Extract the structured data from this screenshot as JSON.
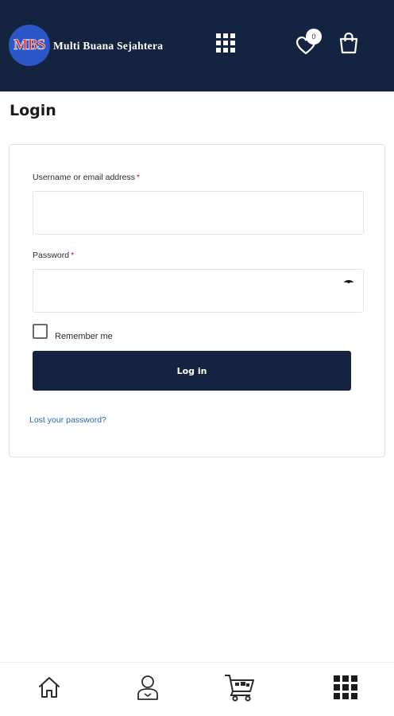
{
  "header": {
    "logo_text": "MBS",
    "brand_name": "Multi Buana Sejahtera",
    "menu_icon": "grid-menu-icon",
    "wishlist_icon": "heart-tag-icon",
    "wishlist_count": "0",
    "cart_icon": "shopping-bag-icon"
  },
  "page": {
    "title": "Login"
  },
  "form": {
    "username_label": "Username or email address",
    "username_value": "",
    "password_label": "Password",
    "password_value": "",
    "required_mark": "*",
    "show_password_icon": "eye-icon",
    "remember_label": "Remember me",
    "remember_checked": false,
    "submit_label": "Log in",
    "lost_password_link": "Lost your password?"
  },
  "bottom_nav": {
    "items": [
      {
        "icon": "home-icon"
      },
      {
        "icon": "user-account-icon"
      },
      {
        "icon": "shopping-cart-icon"
      },
      {
        "icon": "grid-menu-icon"
      }
    ]
  },
  "colors": {
    "header_bg": "#142440",
    "button_bg": "#142440",
    "link": "#2369b4",
    "required": "#c8102e",
    "logo_badge": "#2b56c8",
    "logo_text": "#d8352d"
  }
}
